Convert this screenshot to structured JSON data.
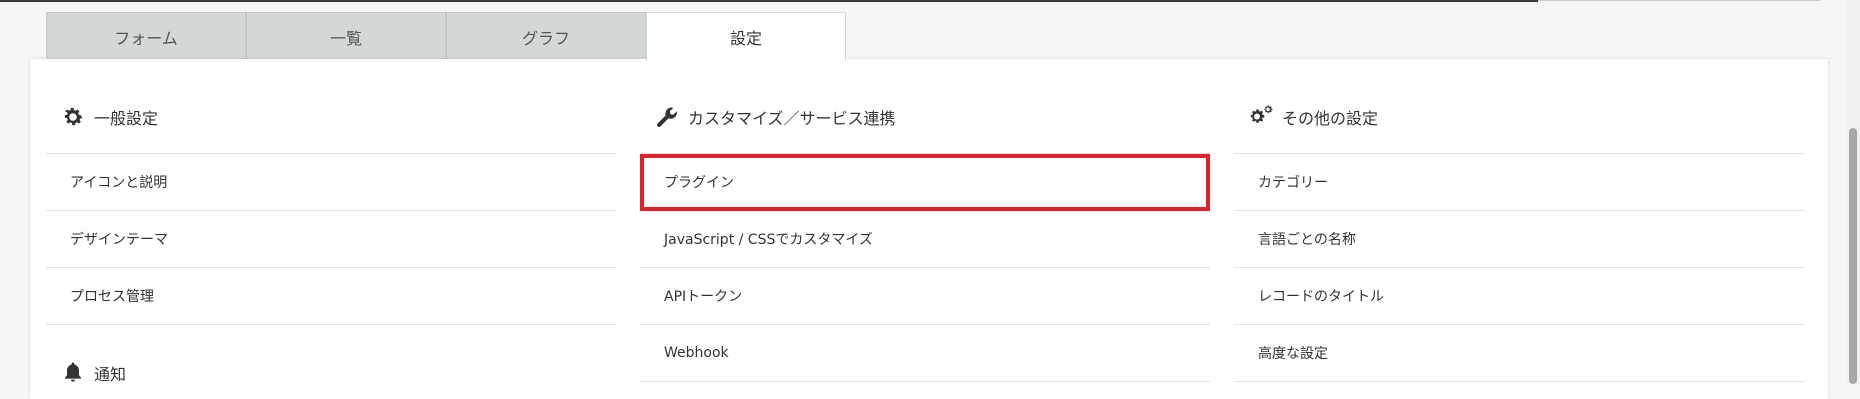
{
  "tabs": [
    {
      "label": "フォーム"
    },
    {
      "label": "一覧"
    },
    {
      "label": "グラフ"
    },
    {
      "label": "設定"
    }
  ],
  "active_tab": "設定",
  "sections": {
    "general": {
      "title": "一般設定",
      "icon": "gear-icon",
      "items": [
        {
          "label": "アイコンと説明"
        },
        {
          "label": "デザインテーマ"
        },
        {
          "label": "プロセス管理"
        }
      ]
    },
    "customize": {
      "title": "カスタマイズ／サービス連携",
      "icon": "wrench-icon",
      "items": [
        {
          "label": "プラグイン"
        },
        {
          "label": "JavaScript / CSSでカスタマイズ"
        },
        {
          "label": "APIトークン"
        },
        {
          "label": "Webhook"
        }
      ]
    },
    "other": {
      "title": "その他の設定",
      "icon": "gears-icon",
      "items": [
        {
          "label": "カテゴリー"
        },
        {
          "label": "言語ごとの名称"
        },
        {
          "label": "レコードのタイトル"
        },
        {
          "label": "高度な設定"
        }
      ]
    },
    "notification": {
      "title": "通知",
      "icon": "bell-icon"
    }
  },
  "highlight_color": "#e0202a"
}
